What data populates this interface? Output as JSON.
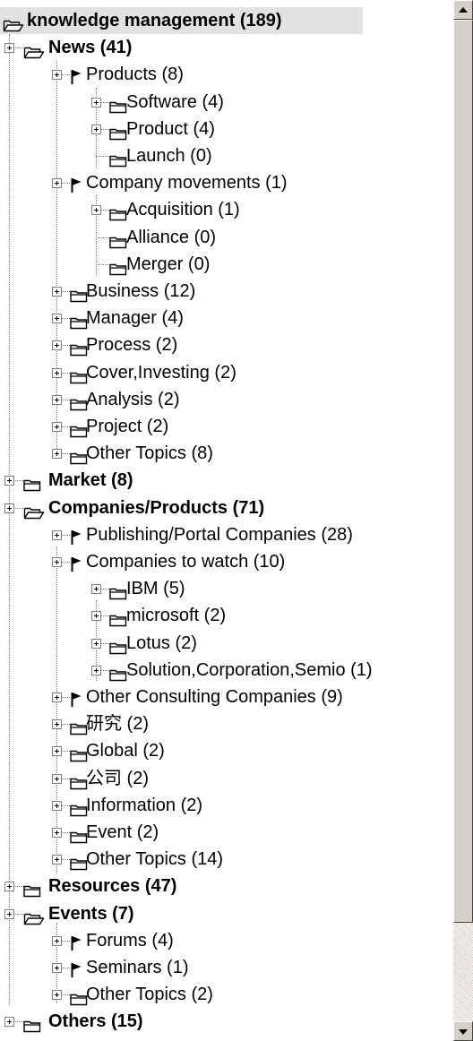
{
  "tree": {
    "root": {
      "label": "knowledge management (189)",
      "icon": "open-folder-icon"
    },
    "nodes": [
      {
        "label": "News (41)",
        "depth": 0,
        "icon": "open-folder-icon",
        "bold": true,
        "expander": true
      },
      {
        "label": "Products (8)",
        "depth": 1,
        "icon": "flag-icon",
        "expander": true
      },
      {
        "label": "Software (4)",
        "depth": 2,
        "icon": "folder-icon",
        "expander": true
      },
      {
        "label": "Product (4)",
        "depth": 2,
        "icon": "folder-icon",
        "expander": true
      },
      {
        "label": "Launch (0)",
        "depth": 2,
        "icon": "folder-icon",
        "expander": false
      },
      {
        "label": "Company movements (1)",
        "depth": 1,
        "icon": "flag-icon",
        "expander": true
      },
      {
        "label": "Acquisition (1)",
        "depth": 2,
        "icon": "folder-icon",
        "expander": true
      },
      {
        "label": "Alliance (0)",
        "depth": 2,
        "icon": "folder-icon",
        "expander": false
      },
      {
        "label": "Merger (0)",
        "depth": 2,
        "icon": "folder-icon",
        "expander": false
      },
      {
        "label": "Business (12)",
        "depth": 1,
        "icon": "folder-icon",
        "expander": true
      },
      {
        "label": "Manager (4)",
        "depth": 1,
        "icon": "folder-icon",
        "expander": true
      },
      {
        "label": "Process (2)",
        "depth": 1,
        "icon": "folder-icon",
        "expander": true
      },
      {
        "label": "Cover,Investing (2)",
        "depth": 1,
        "icon": "folder-icon",
        "expander": true
      },
      {
        "label": "Analysis (2)",
        "depth": 1,
        "icon": "folder-icon",
        "expander": true
      },
      {
        "label": "Project (2)",
        "depth": 1,
        "icon": "folder-icon",
        "expander": true
      },
      {
        "label": "Other Topics (8)",
        "depth": 1,
        "icon": "folder-icon",
        "expander": true
      },
      {
        "label": "Market (8)",
        "depth": 0,
        "icon": "folder-icon",
        "bold": true,
        "expander": true
      },
      {
        "label": "Companies/Products (71)",
        "depth": 0,
        "icon": "open-folder-icon",
        "bold": true,
        "expander": true
      },
      {
        "label": "Publishing/Portal Companies (28)",
        "depth": 1,
        "icon": "flag-icon",
        "expander": true
      },
      {
        "label": "Companies to watch (10)",
        "depth": 1,
        "icon": "flag-icon",
        "expander": true
      },
      {
        "label": "IBM (5)",
        "depth": 2,
        "icon": "folder-icon",
        "expander": true
      },
      {
        "label": "microsoft (2)",
        "depth": 2,
        "icon": "folder-icon",
        "expander": true
      },
      {
        "label": "Lotus (2)",
        "depth": 2,
        "icon": "folder-icon",
        "expander": true
      },
      {
        "label": "Solution,Corporation,Semio (1)",
        "depth": 2,
        "icon": "folder-icon",
        "expander": true
      },
      {
        "label": "Other Consulting Companies (9)",
        "depth": 1,
        "icon": "flag-icon",
        "expander": true
      },
      {
        "label": "研究 (2)",
        "depth": 1,
        "icon": "folder-icon",
        "expander": true
      },
      {
        "label": "Global (2)",
        "depth": 1,
        "icon": "folder-icon",
        "expander": true
      },
      {
        "label": "公司 (2)",
        "depth": 1,
        "icon": "folder-icon",
        "expander": true
      },
      {
        "label": "Information (2)",
        "depth": 1,
        "icon": "folder-icon",
        "expander": true
      },
      {
        "label": "Event (2)",
        "depth": 1,
        "icon": "folder-icon",
        "expander": true
      },
      {
        "label": "Other Topics (14)",
        "depth": 1,
        "icon": "folder-icon",
        "expander": true
      },
      {
        "label": "Resources (47)",
        "depth": 0,
        "icon": "folder-icon",
        "bold": true,
        "expander": true
      },
      {
        "label": "Events (7)",
        "depth": 0,
        "icon": "open-folder-icon",
        "bold": true,
        "expander": true
      },
      {
        "label": "Forums (4)",
        "depth": 1,
        "icon": "flag-icon",
        "expander": true
      },
      {
        "label": "Seminars (1)",
        "depth": 1,
        "icon": "flag-icon",
        "expander": true
      },
      {
        "label": "Other Topics (2)",
        "depth": 1,
        "icon": "folder-icon",
        "expander": true
      },
      {
        "label": "Others (15)",
        "depth": 0,
        "icon": "folder-icon",
        "bold": true,
        "expander": true
      }
    ]
  },
  "scrollbar": {
    "up_icon": "scroll-up-arrow-icon",
    "down_icon": "scroll-down-arrow-icon"
  }
}
